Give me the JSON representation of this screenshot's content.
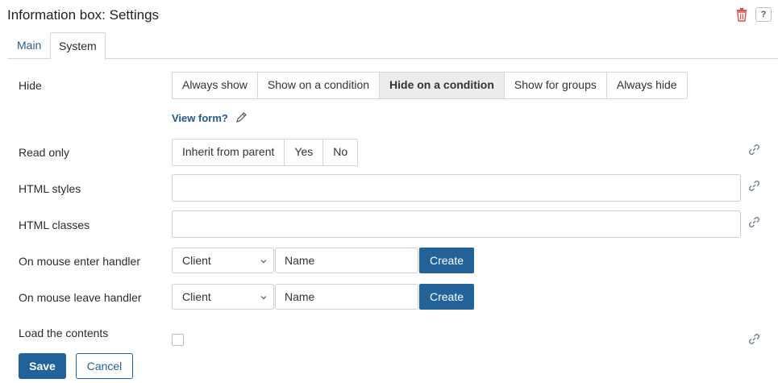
{
  "header": {
    "title": "Information box: Settings",
    "icons": [
      "trash-icon",
      "help-icon"
    ],
    "help_glyph": "?"
  },
  "tabs": [
    {
      "label": "Main",
      "active": false
    },
    {
      "label": "System",
      "active": true
    }
  ],
  "fields": {
    "hide": {
      "label": "Hide",
      "options": [
        "Always show",
        "Show on a condition",
        "Hide on a condition",
        "Show for groups",
        "Always hide"
      ],
      "selected": "Hide on a condition",
      "view_form_label": "View form?"
    },
    "read_only": {
      "label": "Read only",
      "options": [
        "Inherit from parent",
        "Yes",
        "No"
      ],
      "selected": null
    },
    "html_styles": {
      "label": "HTML styles",
      "value": "",
      "placeholder": ""
    },
    "html_classes": {
      "label": "HTML classes",
      "value": "",
      "placeholder": ""
    },
    "mouse_enter": {
      "label": "On mouse enter handler",
      "type_value": "Client",
      "name_value": "Name",
      "create_label": "Create"
    },
    "mouse_leave": {
      "label": "On mouse leave handler",
      "type_value": "Client",
      "name_value": "Name",
      "create_label": "Create"
    },
    "load_contents": {
      "label": "Load the contents",
      "checked": false
    }
  },
  "footer": {
    "save_label": "Save",
    "cancel_label": "Cancel"
  },
  "colors": {
    "primary": "#22629a",
    "link": "#1f5a92",
    "trash": "#d9534f",
    "active_option_bg": "#ececec"
  }
}
